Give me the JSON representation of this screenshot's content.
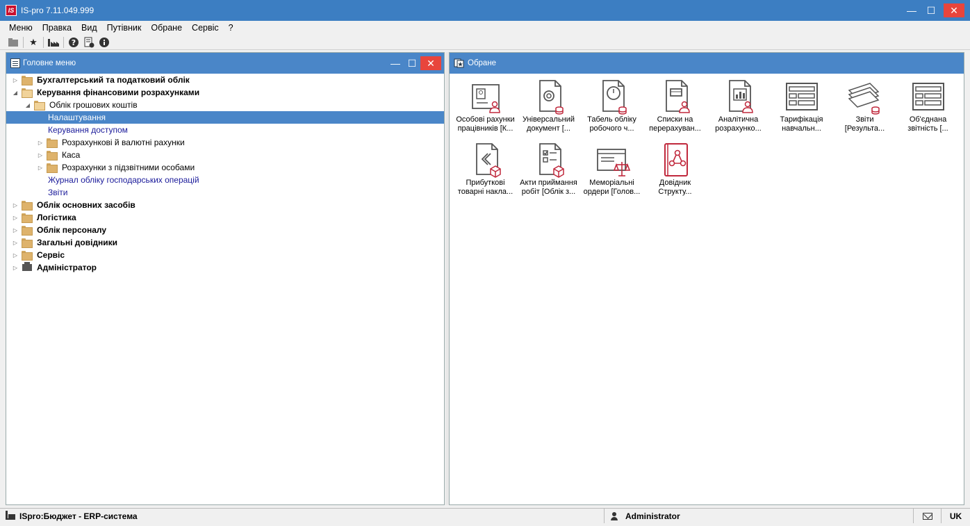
{
  "window": {
    "logo": "IS",
    "title": "IS-pro 7.11.049.999"
  },
  "menu": [
    "Меню",
    "Правка",
    "Вид",
    "Путівник",
    "Обране",
    "Сервіс",
    "?"
  ],
  "left_panel": {
    "title": "Головне меню",
    "tree": [
      {
        "label": "Бухгалтерський та податковий облік",
        "level": 0,
        "arrow": "▷",
        "icon": "folder",
        "bold": true
      },
      {
        "label": "Керування фінансовими розрахунками",
        "level": 0,
        "arrow": "◢",
        "icon": "folder-open",
        "bold": true
      },
      {
        "label": "Облік грошових коштів",
        "level": 1,
        "arrow": "◢",
        "icon": "folder-open"
      },
      {
        "label": "Налаштування",
        "level": 2,
        "arrow": "",
        "icon": "",
        "link": true,
        "selected": true
      },
      {
        "label": "Керування доступом",
        "level": 2,
        "arrow": "",
        "icon": "",
        "link": true
      },
      {
        "label": "Розрахункові й валютні рахунки",
        "level": 2,
        "arrow": "▷",
        "icon": "folder"
      },
      {
        "label": "Каса",
        "level": 2,
        "arrow": "▷",
        "icon": "folder"
      },
      {
        "label": "Розрахунки з підзвітними особами",
        "level": 2,
        "arrow": "▷",
        "icon": "folder"
      },
      {
        "label": "Журнал обліку господарських операцій",
        "level": 2,
        "arrow": "",
        "icon": "",
        "link": true
      },
      {
        "label": "Звіти",
        "level": 2,
        "arrow": "",
        "icon": "",
        "link": true
      },
      {
        "label": "Облік основних засобів",
        "level": 0,
        "arrow": "▷",
        "icon": "folder",
        "bold": true
      },
      {
        "label": "Логістика",
        "level": 0,
        "arrow": "▷",
        "icon": "folder",
        "bold": true
      },
      {
        "label": "Облік персоналу",
        "level": 0,
        "arrow": "▷",
        "icon": "folder",
        "bold": true
      },
      {
        "label": "Загальні довідники",
        "level": 0,
        "arrow": "▷",
        "icon": "folder",
        "bold": true
      },
      {
        "label": "Сервіс",
        "level": 0,
        "arrow": "▷",
        "icon": "folder",
        "bold": true
      },
      {
        "label": "Адміністратор",
        "level": 0,
        "arrow": "▷",
        "icon": "admin",
        "bold": true
      }
    ]
  },
  "right_panel": {
    "title": "Обране",
    "items": [
      {
        "label": "Особові рахунки\nпрацівників [К...",
        "icon": "personal-accounts-icon"
      },
      {
        "label": "Універсальний\nдокумент [...",
        "icon": "universal-document-icon"
      },
      {
        "label": "Табель обліку\nробочого ч...",
        "icon": "timesheet-icon"
      },
      {
        "label": "Списки на\nперерахуван...",
        "icon": "transfer-lists-icon"
      },
      {
        "label": "Аналітична\nрозрахунко...",
        "icon": "analytics-icon"
      },
      {
        "label": "Тарифікація\nнавчальн...",
        "icon": "tariffing-icon"
      },
      {
        "label": "Звіти\n[Результа...",
        "icon": "reports-icon"
      },
      {
        "label": "Об'єднана\nзвітність [...",
        "icon": "combined-reports-icon"
      },
      {
        "label": "Прибуткові\nтоварні накла...",
        "icon": "income-invoices-icon"
      },
      {
        "label": "Акти приймання\nробіт [Облік з...",
        "icon": "acceptance-acts-icon"
      },
      {
        "label": "Меморіальні\nордери [Голов...",
        "icon": "memorial-orders-icon"
      },
      {
        "label": "Довідник\nСтрукту...",
        "icon": "structure-directory-icon"
      }
    ]
  },
  "status": {
    "system": "ISpro:Бюджет - ERP-система",
    "user": "Administrator",
    "lang": "UK"
  },
  "colors": {
    "title": "#3c7ec2",
    "header": "#4a86c8",
    "accent_red": "#c0283c",
    "icon_gray": "#555555"
  }
}
